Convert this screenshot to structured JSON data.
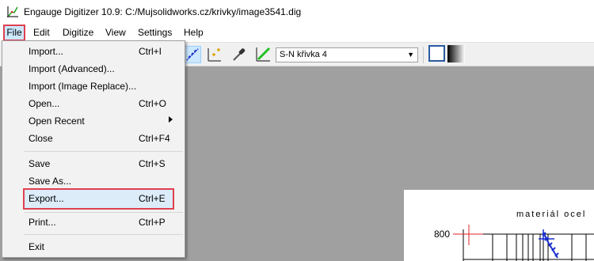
{
  "window": {
    "title": "Engauge Digitizer 10.9: C:/Mujsolidworks.cz/krivky/image3541.dig",
    "app_icon": "engauge-app-icon"
  },
  "menubar": {
    "items": [
      {
        "label": "File"
      },
      {
        "label": "Edit"
      },
      {
        "label": "Digitize"
      },
      {
        "label": "View"
      },
      {
        "label": "Settings"
      },
      {
        "label": "Help"
      }
    ],
    "open_menu": "File"
  },
  "toolbar": {
    "curve_select": {
      "value": "S-N křivka 4"
    },
    "icons": [
      "digitize-point-icon",
      "axis-point-icon",
      "color-picker-icon",
      "segment-fill-icon"
    ],
    "background_options": [
      "white-background-swatch",
      "gradient-background-swatch"
    ]
  },
  "file_menu": {
    "items": [
      {
        "label": "Import...",
        "shortcut": "Ctrl+I"
      },
      {
        "label": "Import (Advanced)...",
        "shortcut": ""
      },
      {
        "label": "Import (Image Replace)...",
        "shortcut": ""
      },
      {
        "label": "Open...",
        "shortcut": "Ctrl+O"
      },
      {
        "label": "Open Recent",
        "shortcut": "",
        "submenu": true
      },
      {
        "label": "Close",
        "shortcut": "Ctrl+F4"
      },
      {
        "label": "Save",
        "shortcut": "Ctrl+S"
      },
      {
        "label": "Save As...",
        "shortcut": ""
      },
      {
        "label": "Export...",
        "shortcut": "Ctrl+E",
        "highlighted": true
      },
      {
        "label": "Print...",
        "shortcut": "Ctrl+P"
      },
      {
        "label": "Exit",
        "shortcut": ""
      }
    ]
  },
  "graph": {
    "title": "materiál ocel",
    "y_tick_label": "800"
  },
  "colors": {
    "highlight_border": "#e04050",
    "menu_hover": "#cce8ff",
    "workspace": "#a0a0a0",
    "curve_blue": "#1a2fd0"
  }
}
